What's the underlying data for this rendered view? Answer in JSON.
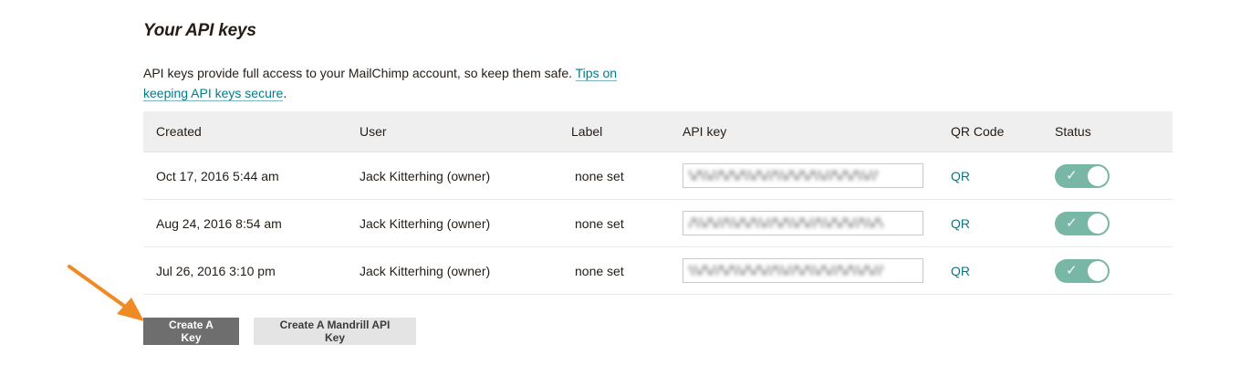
{
  "section": {
    "heading": "Your API keys",
    "intro_text": "API keys provide full access to your MailChimp account, so keep them safe. ",
    "intro_link": "Tips on keeping API keys secure",
    "intro_end": "."
  },
  "table": {
    "headers": {
      "created": "Created",
      "user": "User",
      "label": "Label",
      "api_key": "API key",
      "qr_code": "QR Code",
      "status": "Status"
    },
    "rows": [
      {
        "created": "Oct 17, 2016 5:44 am",
        "user": "Jack Kitterhing (owner)",
        "label": "none set",
        "api_key": "",
        "qr": "QR",
        "status_enabled": true
      },
      {
        "created": "Aug 24, 2016 8:54 am",
        "user": "Jack Kitterhing (owner)",
        "label": "none set",
        "api_key": "",
        "qr": "QR",
        "status_enabled": true
      },
      {
        "created": "Jul 26, 2016 3:10 pm",
        "user": "Jack Kitterhing (owner)",
        "label": "none set",
        "api_key": "",
        "qr": "QR",
        "status_enabled": true
      }
    ]
  },
  "actions": {
    "create_key": "Create A Key",
    "create_mandrill_key": "Create A Mandrill API Key"
  },
  "icons": {
    "toggle_check": "check-icon",
    "annotation_arrow": "arrow-icon"
  },
  "colors": {
    "link": "#007c89",
    "toggle_on": "#78b6a6",
    "primary_button": "#6e6e6e",
    "secondary_button": "#e4e4e4",
    "annotation_arrow": "#f08a24",
    "header_bg": "#efefef"
  }
}
